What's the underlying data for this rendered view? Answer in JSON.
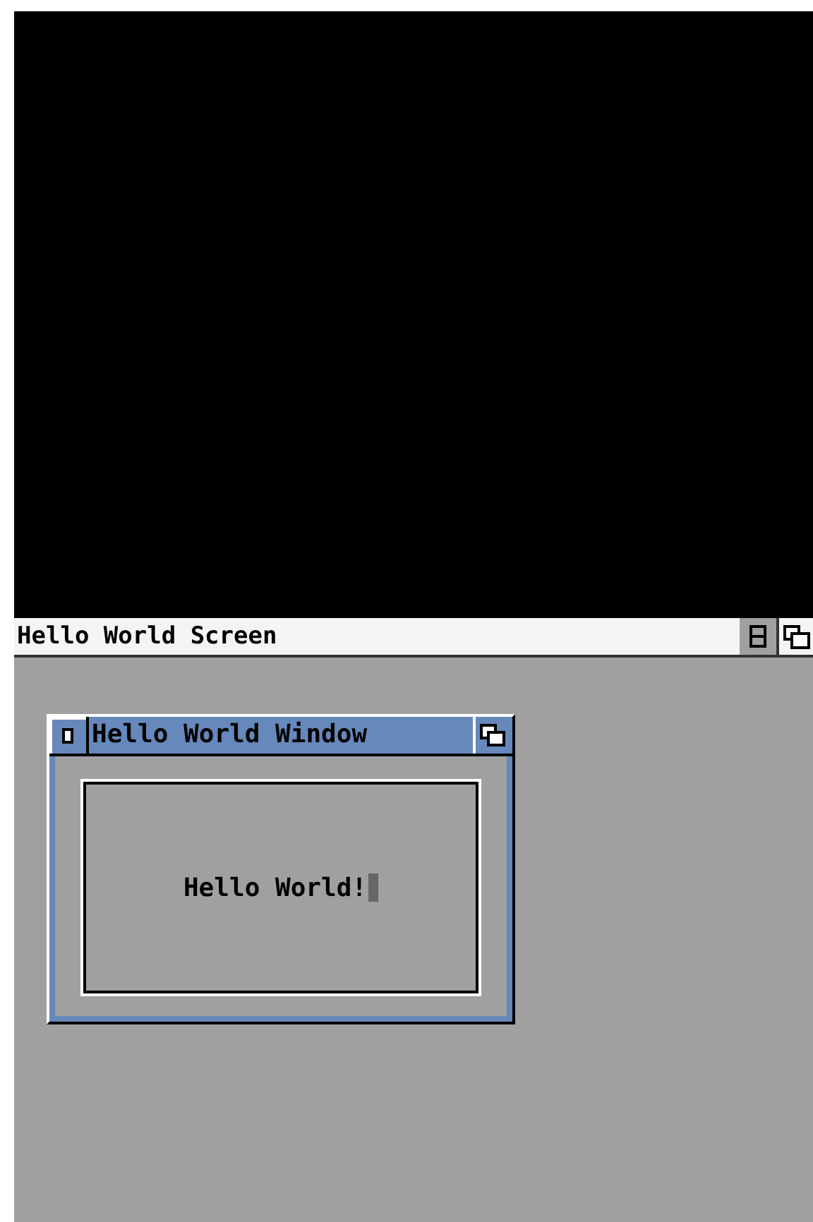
{
  "screen": {
    "title": "Hello World Screen"
  },
  "window": {
    "title": "Hello World Window",
    "text": "Hello World!"
  }
}
